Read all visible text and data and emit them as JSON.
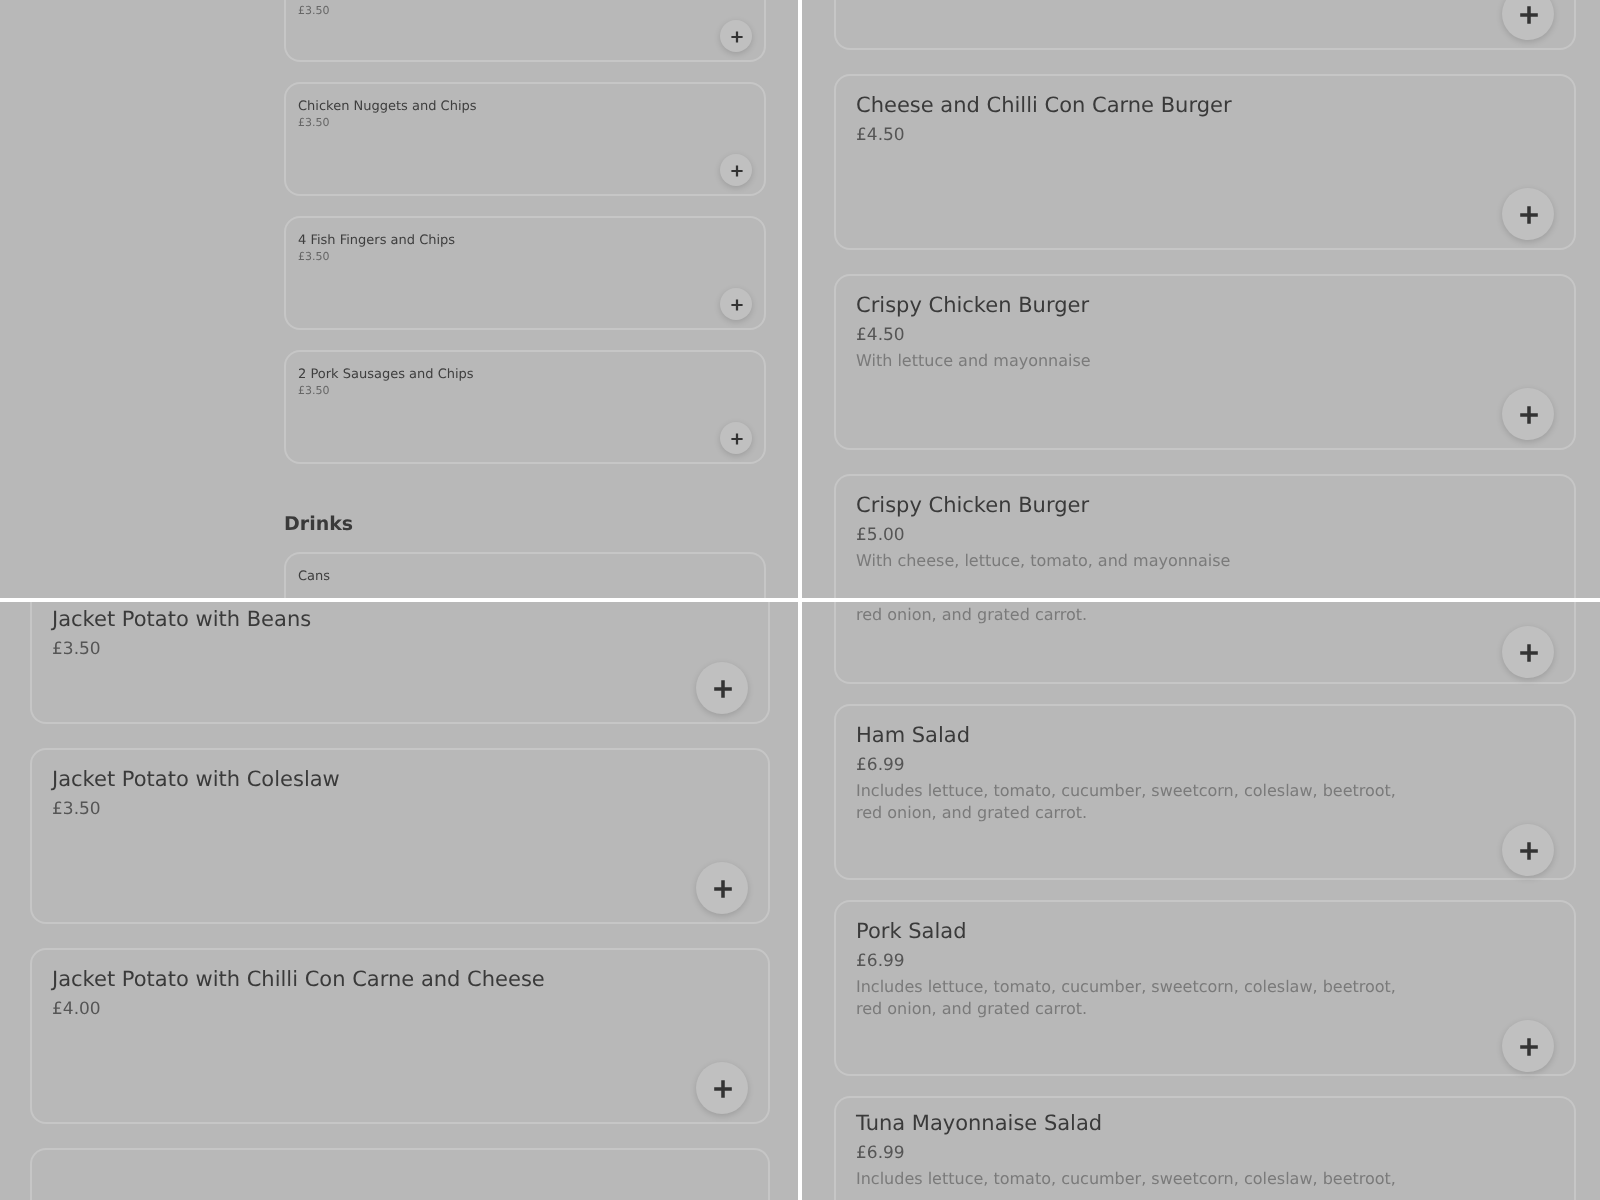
{
  "panels": [
    {
      "kind": "compact",
      "entries": [
        {
          "kind": "item",
          "price": "£3.50"
        },
        {
          "kind": "item",
          "name": "Chicken Nuggets and Chips",
          "price": "£3.50"
        },
        {
          "kind": "item",
          "name": "4 Fish Fingers and Chips",
          "price": "£3.50"
        },
        {
          "kind": "item",
          "name": "2 Pork Sausages and Chips",
          "price": "£3.50"
        },
        {
          "kind": "heading",
          "text": "Drinks"
        },
        {
          "kind": "item",
          "name": "Cans"
        }
      ]
    },
    {
      "kind": "regular",
      "entries": [
        {
          "kind": "item"
        },
        {
          "kind": "item",
          "name": "Cheese and Chilli Con Carne Burger",
          "price": "£4.50"
        },
        {
          "kind": "item",
          "name": "Crispy Chicken Burger",
          "price": "£4.50",
          "description": "With lettuce and mayonnaise"
        },
        {
          "kind": "item",
          "name": "Crispy Chicken Burger",
          "price": "£5.00",
          "description": "With cheese, lettuce, tomato, and mayonnaise"
        }
      ]
    },
    {
      "kind": "regular",
      "entries": [
        {
          "kind": "item",
          "name": "Jacket Potato with Beans",
          "price": "£3.50"
        },
        {
          "kind": "item",
          "name": "Jacket Potato with Coleslaw",
          "price": "£3.50"
        },
        {
          "kind": "item",
          "name": "Jacket Potato with Chilli Con Carne and Cheese",
          "price": "£4.00"
        },
        {
          "kind": "item"
        }
      ]
    },
    {
      "kind": "regular",
      "entries": [
        {
          "kind": "item",
          "description": "red onion, and grated carrot."
        },
        {
          "kind": "item",
          "name": "Ham Salad",
          "price": "£6.99",
          "description": "Includes lettuce, tomato, cucumber, sweetcorn, coleslaw, beetroot, red onion, and grated carrot."
        },
        {
          "kind": "item",
          "name": "Pork Salad",
          "price": "£6.99",
          "description": "Includes lettuce, tomato, cucumber, sweetcorn, coleslaw, beetroot, red onion, and grated carrot."
        },
        {
          "kind": "item",
          "name": "Tuna Mayonnaise Salad",
          "price": "£6.99",
          "description": "Includes lettuce, tomato, cucumber, sweetcorn, coleslaw, beetroot,"
        }
      ]
    }
  ]
}
